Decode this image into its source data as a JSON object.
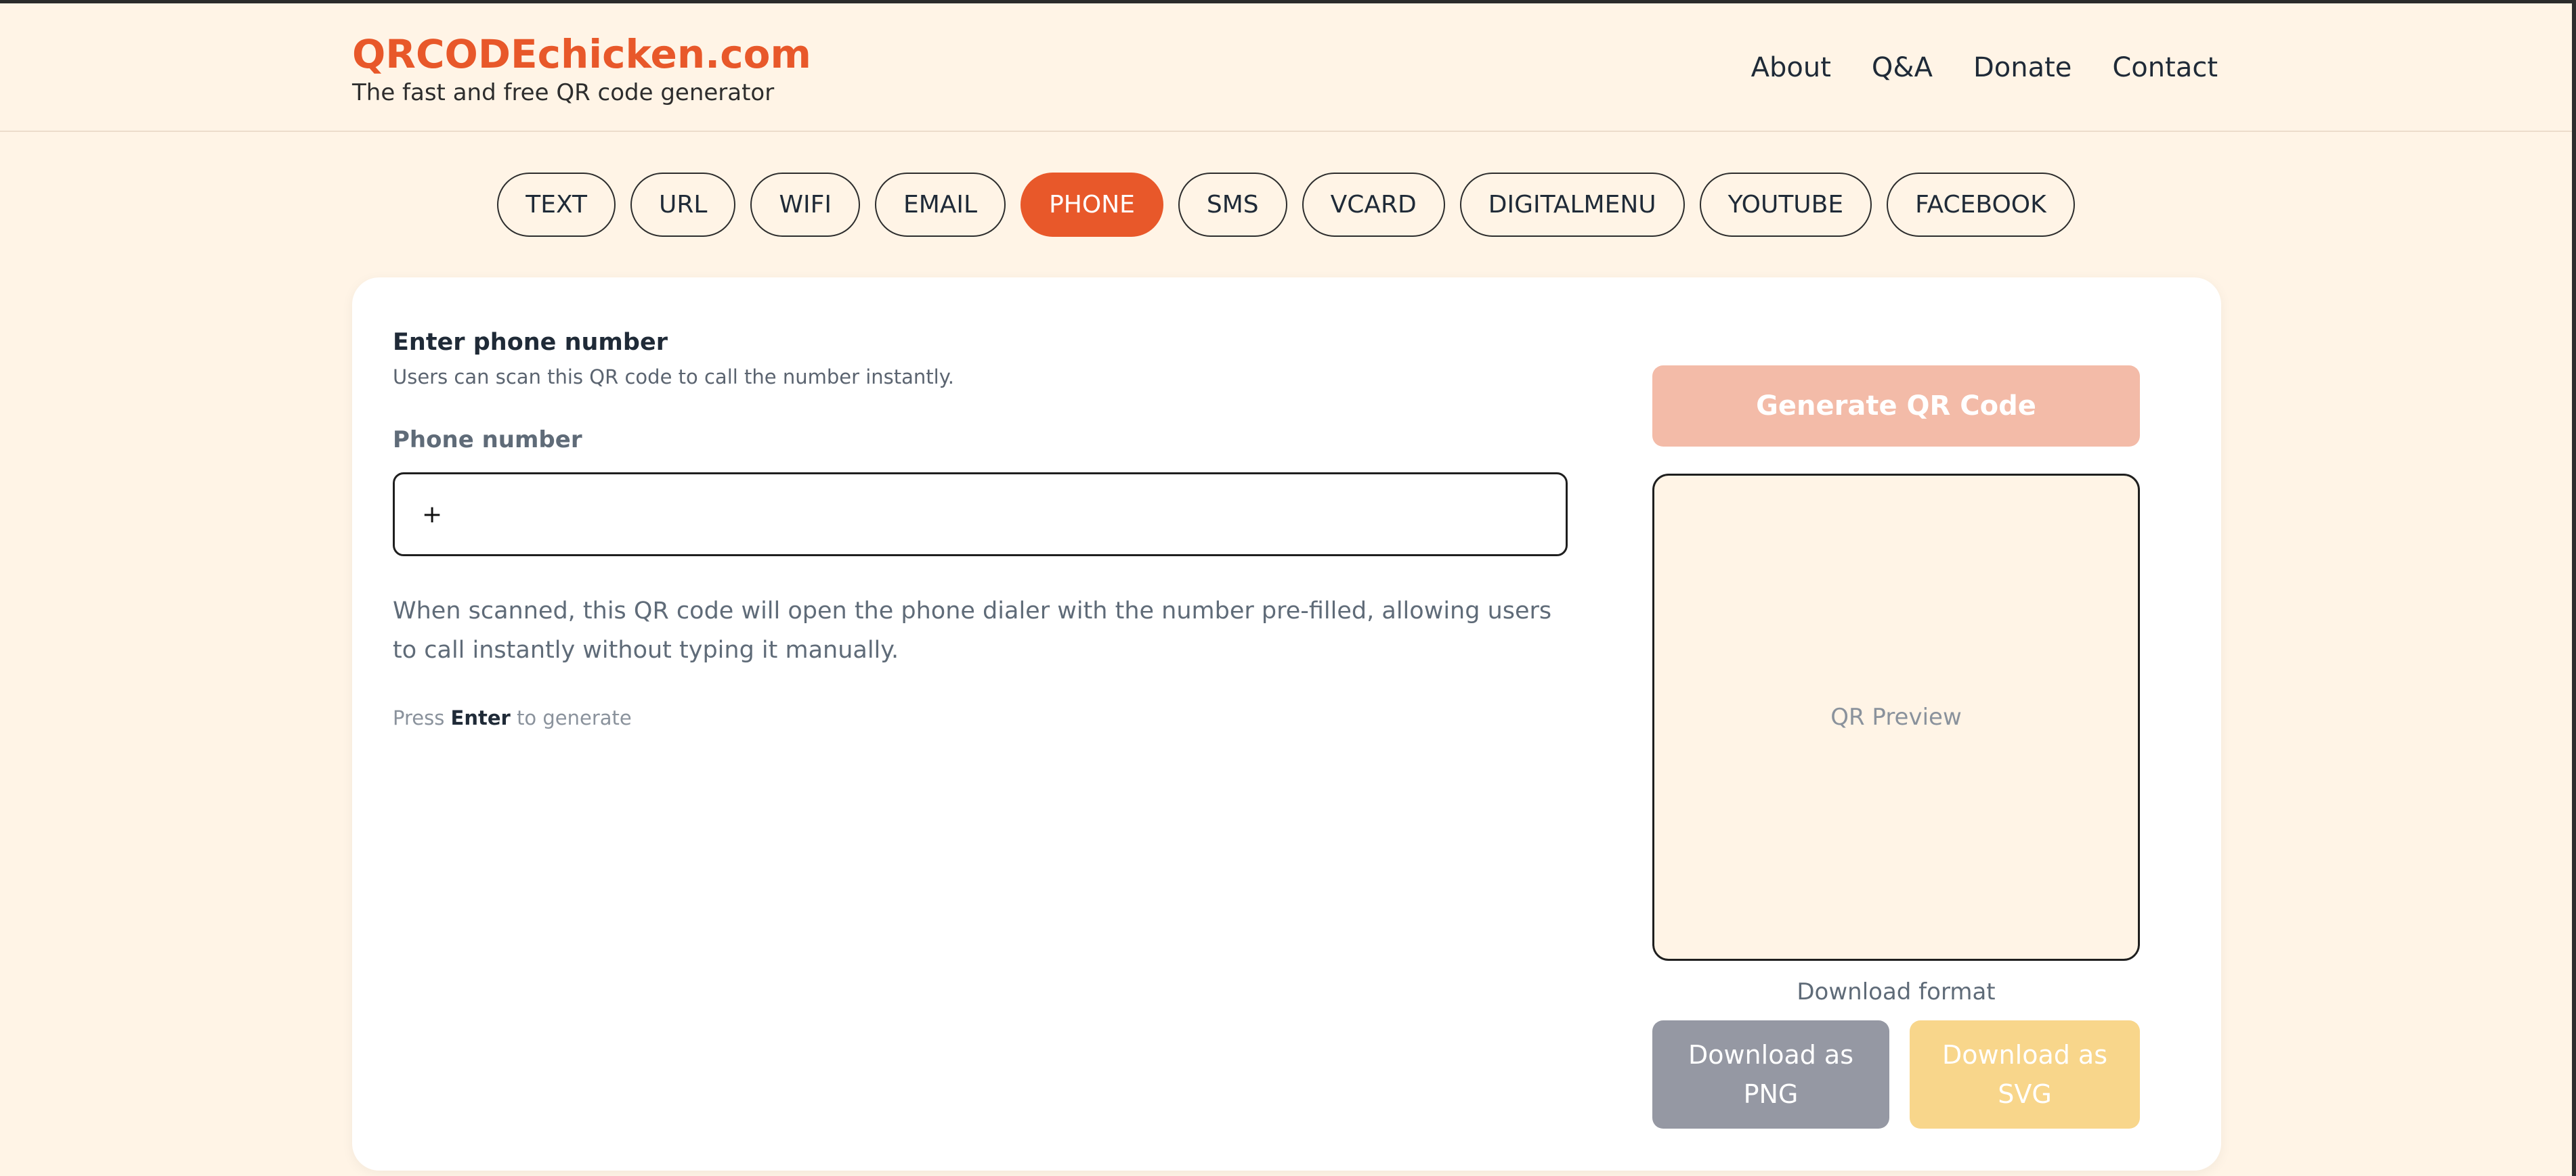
{
  "header": {
    "brand_name": "QRCODEchicken.com",
    "tagline": "The fast and free QR code generator",
    "nav": [
      {
        "label": "About"
      },
      {
        "label": "Q&A"
      },
      {
        "label": "Donate"
      },
      {
        "label": "Contact"
      }
    ]
  },
  "tabs": [
    {
      "label": "TEXT"
    },
    {
      "label": "URL"
    },
    {
      "label": "WIFI"
    },
    {
      "label": "EMAIL"
    },
    {
      "label": "PHONE",
      "active": true
    },
    {
      "label": "SMS"
    },
    {
      "label": "VCARD"
    },
    {
      "label": "DIGITALMENU"
    },
    {
      "label": "YOUTUBE"
    },
    {
      "label": "FACEBOOK"
    }
  ],
  "form": {
    "title": "Enter phone number",
    "subtitle": "Users can scan this QR code to call the number instantly.",
    "field_label": "Phone number",
    "phone_value": "+",
    "help_text": "When scanned, this QR code will open the phone dialer with the number pre-filled, allowing users to call instantly without typing it manually.",
    "hint_prefix": "Press",
    "hint_key": "Enter",
    "hint_suffix": "to generate"
  },
  "preview": {
    "generate_label": "Generate QR Code",
    "placeholder": "QR Preview",
    "download_format_label": "Download format",
    "download_png": "Download as PNG",
    "download_svg": "Download as SVG"
  },
  "colors": {
    "brand": "#e8582a",
    "background": "#fff4e6",
    "generate_disabled": "#f3bba8",
    "download_png": "#9598a3",
    "download_svg": "#f8d68b"
  }
}
